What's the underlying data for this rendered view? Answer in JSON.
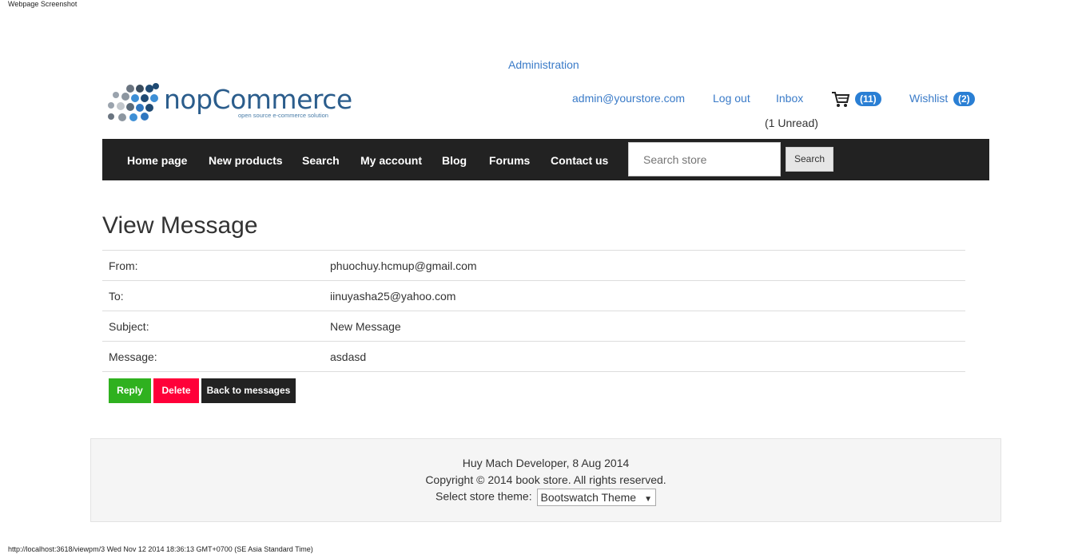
{
  "window": {
    "caption": "Webpage Screenshot"
  },
  "header": {
    "admin_link": "Administration",
    "logo": {
      "name": "nopCommerce",
      "tagline": "open source e-commerce solution",
      "icon": "dot-cluster-logo"
    },
    "links": {
      "account": "admin@yourstore.com",
      "logout": "Log out",
      "inbox": "Inbox",
      "unread": "(1 Unread)",
      "cart_icon": "shopping-cart-icon",
      "cart_count": "(11)",
      "wishlist": "Wishlist",
      "wishlist_count": "(2)"
    }
  },
  "nav": {
    "items": [
      "Home page",
      "New products",
      "Search",
      "My account",
      "Blog",
      "Forums",
      "Contact us"
    ],
    "search_placeholder": "Search store",
    "search_button": "Search"
  },
  "main": {
    "title": "View Message",
    "rows": [
      {
        "label": "From:",
        "value": "phuochuy.hcmup@gmail.com"
      },
      {
        "label": "To:",
        "value": "iinuyasha25@yahoo.com"
      },
      {
        "label": "Subject:",
        "value": "New Message"
      },
      {
        "label": "Message:",
        "value": "asdasd"
      }
    ],
    "buttons": {
      "reply": "Reply",
      "delete": "Delete",
      "back": "Back to messages"
    }
  },
  "footer": {
    "line1": "Huy Mach Developer, 8 Aug 2014",
    "line2": "Copyright © 2014 book store. All rights reserved.",
    "theme_label": "Select store theme:",
    "theme_value": "Bootswatch Theme"
  },
  "status_bar": "http://localhost:3618/viewpm/3 Wed Nov 12 2014 18:36:13 GMT+0700 (SE Asia Standard Time)",
  "colors": {
    "link": "#3a7bc8",
    "badge": "#2a7fd4",
    "navbar": "#222222",
    "reply": "#2fb11f",
    "delete": "#ff0039",
    "back": "#222222",
    "footer_bg": "#f5f5f5"
  }
}
